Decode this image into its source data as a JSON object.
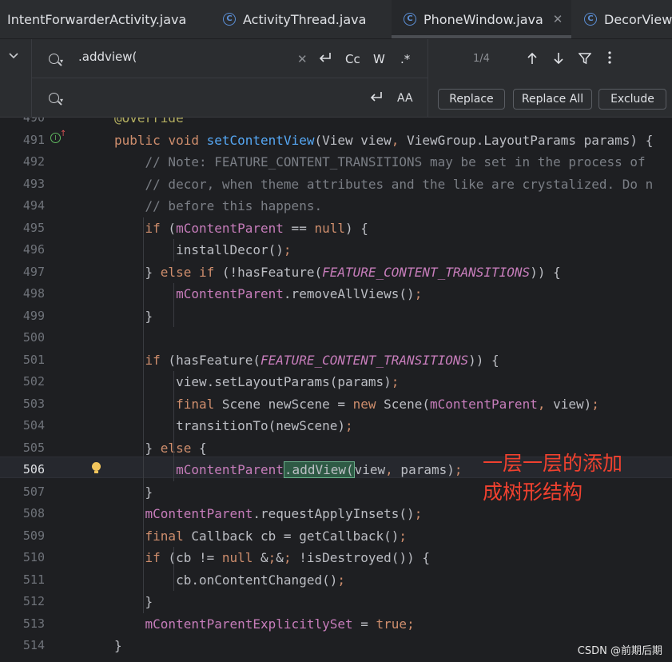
{
  "tabs": [
    {
      "label": "IntentForwarderActivity.java",
      "icon": null,
      "active": false
    },
    {
      "label": "ActivityThread.java",
      "icon": "class-icon",
      "active": false
    },
    {
      "label": "PhoneWindow.java",
      "icon": "class-icon",
      "active": true
    },
    {
      "label": "DecorView.j",
      "icon": "class-icon",
      "active": false
    }
  ],
  "find": {
    "query": ".addview(",
    "replace_value": "",
    "match_case_label": "Cc",
    "words_label": "W",
    "regex_label": ".*",
    "replace_preserve_label": "AA",
    "count": "1/4"
  },
  "buttons": {
    "replace": "Replace",
    "replace_all": "Replace All",
    "exclude": "Exclude"
  },
  "annotation": {
    "line1": "一层一层的添加",
    "line2": "成树形结构",
    "color": "#f0412f"
  },
  "watermark": "CSDN @前期后期",
  "lines": [
    {
      "n": "490",
      "t": "@Override"
    },
    {
      "n": "491",
      "t": "public void setContentView(View view, ViewGroup.LayoutParams params) {"
    },
    {
      "n": "492",
      "t": "    // Note: FEATURE_CONTENT_TRANSITIONS may be set in the process of"
    },
    {
      "n": "493",
      "t": "    // decor, when theme attributes and the like are crystalized. Do n"
    },
    {
      "n": "494",
      "t": "    // before this happens."
    },
    {
      "n": "495",
      "t": "    if (mContentParent == null) {"
    },
    {
      "n": "496",
      "t": "        installDecor();"
    },
    {
      "n": "497",
      "t": "    } else if (!hasFeature(FEATURE_CONTENT_TRANSITIONS)) {"
    },
    {
      "n": "498",
      "t": "        mContentParent.removeAllViews();"
    },
    {
      "n": "499",
      "t": "    }"
    },
    {
      "n": "500",
      "t": ""
    },
    {
      "n": "501",
      "t": "    if (hasFeature(FEATURE_CONTENT_TRANSITIONS)) {"
    },
    {
      "n": "502",
      "t": "        view.setLayoutParams(params);"
    },
    {
      "n": "503",
      "t": "        final Scene newScene = new Scene(mContentParent, view);"
    },
    {
      "n": "504",
      "t": "        transitionTo(newScene);"
    },
    {
      "n": "505",
      "t": "    } else {"
    },
    {
      "n": "506",
      "t": "        mContentParent.addView(view, params);"
    },
    {
      "n": "507",
      "t": "    }"
    },
    {
      "n": "508",
      "t": "    mContentParent.requestApplyInsets();"
    },
    {
      "n": "509",
      "t": "    final Callback cb = getCallback();"
    },
    {
      "n": "510",
      "t": "    if (cb != null && !isDestroyed()) {"
    },
    {
      "n": "511",
      "t": "        cb.onContentChanged();"
    },
    {
      "n": "512",
      "t": "    }"
    },
    {
      "n": "513",
      "t": "    mContentParentExplicitlySet = true;"
    },
    {
      "n": "514",
      "t": "}"
    }
  ],
  "highlight_match": ".addView(",
  "current_line": "506"
}
